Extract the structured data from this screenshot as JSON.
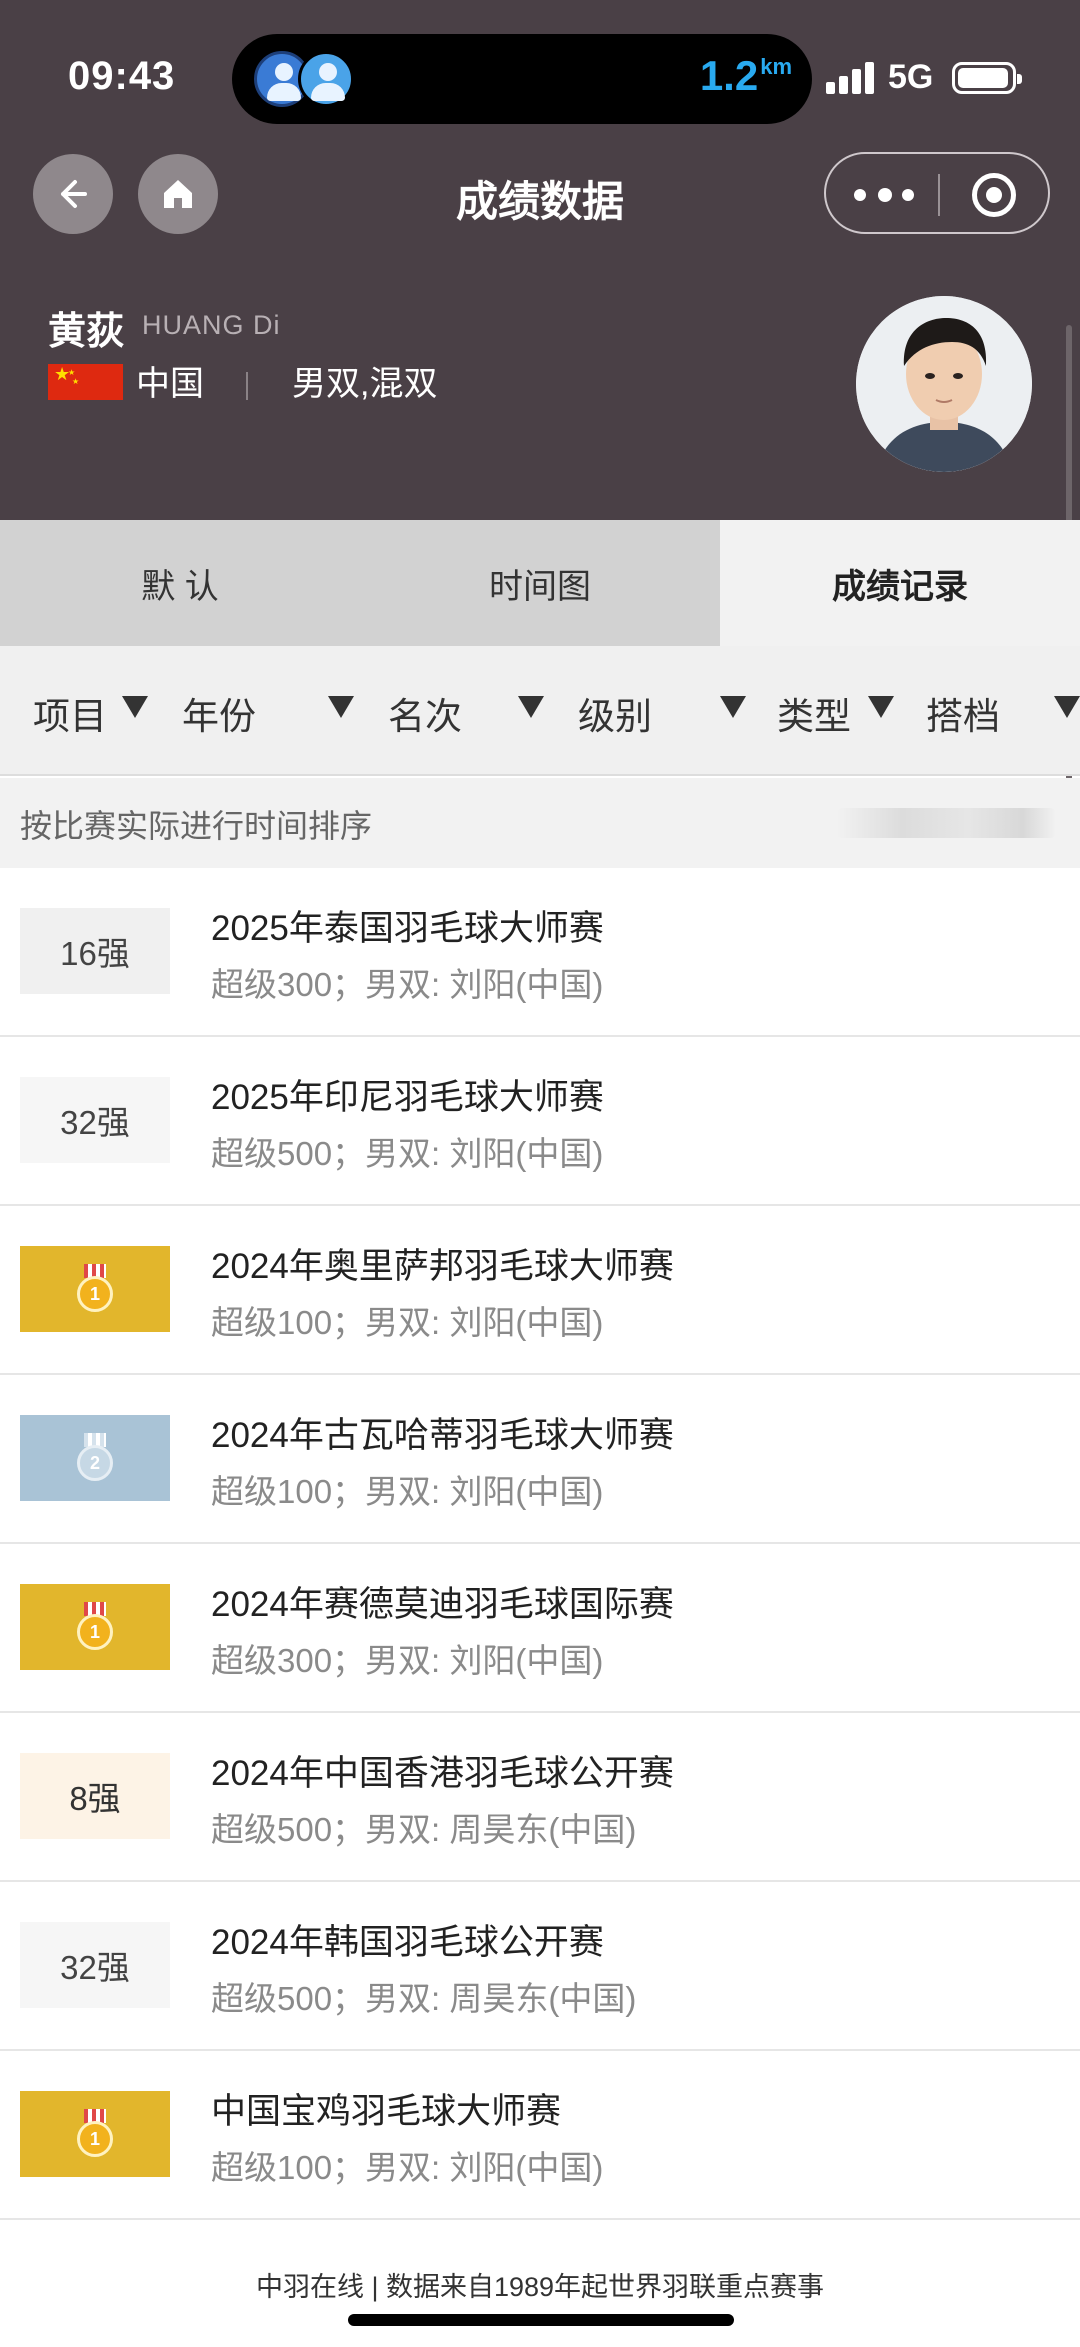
{
  "status_bar": {
    "time": "09:43",
    "distance_value": "1.2",
    "distance_unit": "km",
    "network": "5G"
  },
  "navbar": {
    "title": "成绩数据",
    "back_icon": "arrow-left-icon",
    "home_icon": "home-icon",
    "more_icon": "more-dots-icon",
    "close_icon": "target-close-icon"
  },
  "profile": {
    "name": "黄荻",
    "name_en": "HUANG Di",
    "country": "中国",
    "separator": "|",
    "events": "男双,混双",
    "flag_icon": "china-flag-icon"
  },
  "tabs": [
    {
      "label": "默 认",
      "active": false
    },
    {
      "label": "时间图",
      "active": false
    },
    {
      "label": "成绩记录",
      "active": true
    }
  ],
  "filters": [
    {
      "label": "项目"
    },
    {
      "label": "年份"
    },
    {
      "label": "名次"
    },
    {
      "label": "级别"
    },
    {
      "label": "类型"
    },
    {
      "label": "搭档"
    }
  ],
  "sort": {
    "text": "按比赛实际进行时间排序"
  },
  "results": [
    {
      "badge_type": "rank",
      "badge": "16强",
      "title": "2025年泰国羽毛球大师赛",
      "detail": "超级300；男双: 刘阳(中国)"
    },
    {
      "badge_type": "rank",
      "badge": "32强",
      "title": "2025年印尼羽毛球大师赛",
      "detail": "超级500；男双: 刘阳(中国)"
    },
    {
      "badge_type": "gold",
      "badge": "1",
      "title": "2024年奥里萨邦羽毛球大师赛",
      "detail": "超级100；男双: 刘阳(中国)"
    },
    {
      "badge_type": "silver",
      "badge": "2",
      "title": "2024年古瓦哈蒂羽毛球大师赛",
      "detail": "超级100；男双: 刘阳(中国)"
    },
    {
      "badge_type": "gold",
      "badge": "1",
      "title": "2024年赛德莫迪羽毛球国际赛",
      "detail": "超级300；男双: 刘阳(中国)"
    },
    {
      "badge_type": "rank8",
      "badge": "8强",
      "title": "2024年中国香港羽毛球公开赛",
      "detail": "超级500；男双: 周昊东(中国)"
    },
    {
      "badge_type": "rank",
      "badge": "32强",
      "title": "2024年韩国羽毛球公开赛",
      "detail": "超级500；男双: 周昊东(中国)"
    },
    {
      "badge_type": "gold",
      "badge": "1",
      "title": "中国宝鸡羽毛球大师赛",
      "detail": "超级100；男双: 刘阳(中国)"
    }
  ],
  "footer": {
    "text": "中羽在线 | 数据来自1989年起世界羽联重点赛事"
  },
  "colors": {
    "header_bg": "#4a4046",
    "gold": "#e2b62c",
    "silver": "#a9c3d6",
    "accent_blue": "#29aaf0"
  }
}
